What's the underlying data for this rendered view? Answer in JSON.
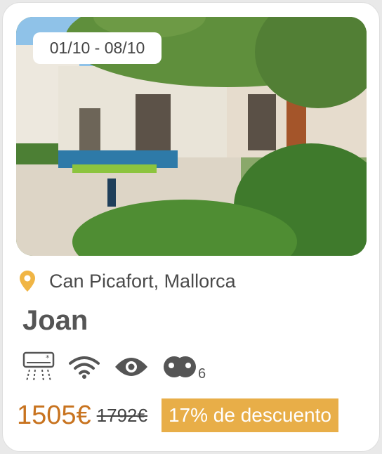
{
  "listing": {
    "dates": "01/10 - 08/10",
    "location": "Can Picafort, Mallorca",
    "name": "Joan",
    "amenities": [
      {
        "icon": "air-conditioning-icon"
      },
      {
        "icon": "wifi-icon"
      },
      {
        "icon": "view-icon"
      },
      {
        "icon": "guests-icon",
        "count": "6"
      }
    ],
    "price": {
      "current": "1505€",
      "original": "1792€",
      "discount": "17% de descuento"
    }
  },
  "colors": {
    "accent": "#e8ae48",
    "price": "#c8731f",
    "pin": "#f0b545"
  }
}
